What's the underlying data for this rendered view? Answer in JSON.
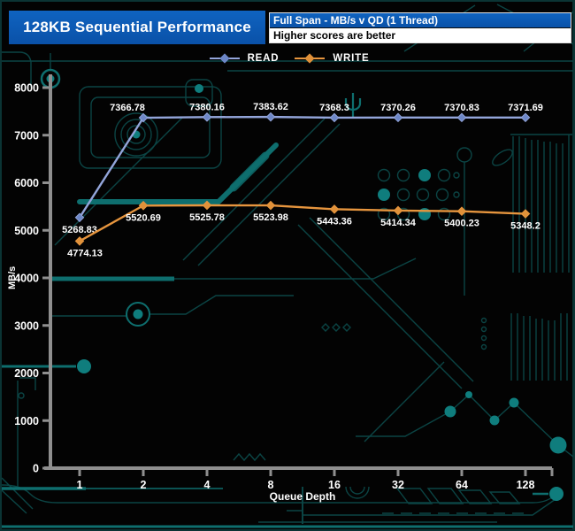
{
  "header": {
    "title": "128KB Sequential Performance",
    "subtitle": "Full Span - MB/s v QD (1 Thread)",
    "note": "Higher scores are better"
  },
  "legend": [
    {
      "label": "READ",
      "color": "#93a5da",
      "marker_color": "#6d87c7"
    },
    {
      "label": "WRITE",
      "color": "#e6953e",
      "marker_color": "#e0913a"
    }
  ],
  "colors": {
    "header_blue": "#0d5ab4",
    "background": "#030303",
    "circuit_teal": "#0c4848",
    "circuit_bright_teal": "#0e6e6e",
    "axis_gray": "#8f8f8f",
    "text_white": "#ffffff"
  },
  "chart_data": {
    "type": "line",
    "title": "128KB Sequential Performance",
    "categories": [
      "1",
      "2",
      "4",
      "8",
      "16",
      "32",
      "64",
      "128"
    ],
    "xlabel": "Queue Depth",
    "ylabel": "MB/s",
    "ylim": [
      0,
      8000
    ],
    "ytick_interval": 1000,
    "grid": false,
    "legend_position": "top",
    "series": [
      {
        "name": "READ",
        "color": "#93a5da",
        "marker_color": "#6d87c7",
        "marker": "diamond",
        "values": [
          5268.83,
          7366.78,
          7380.16,
          7383.62,
          7368.3,
          7370.26,
          7370.83,
          7371.69
        ]
      },
      {
        "name": "WRITE",
        "color": "#e6953e",
        "marker_color": "#e0913a",
        "marker": "diamond",
        "values": [
          4774.13,
          5520.69,
          5525.78,
          5523.98,
          5443.36,
          5414.34,
          5400.23,
          5348.2
        ]
      }
    ]
  }
}
